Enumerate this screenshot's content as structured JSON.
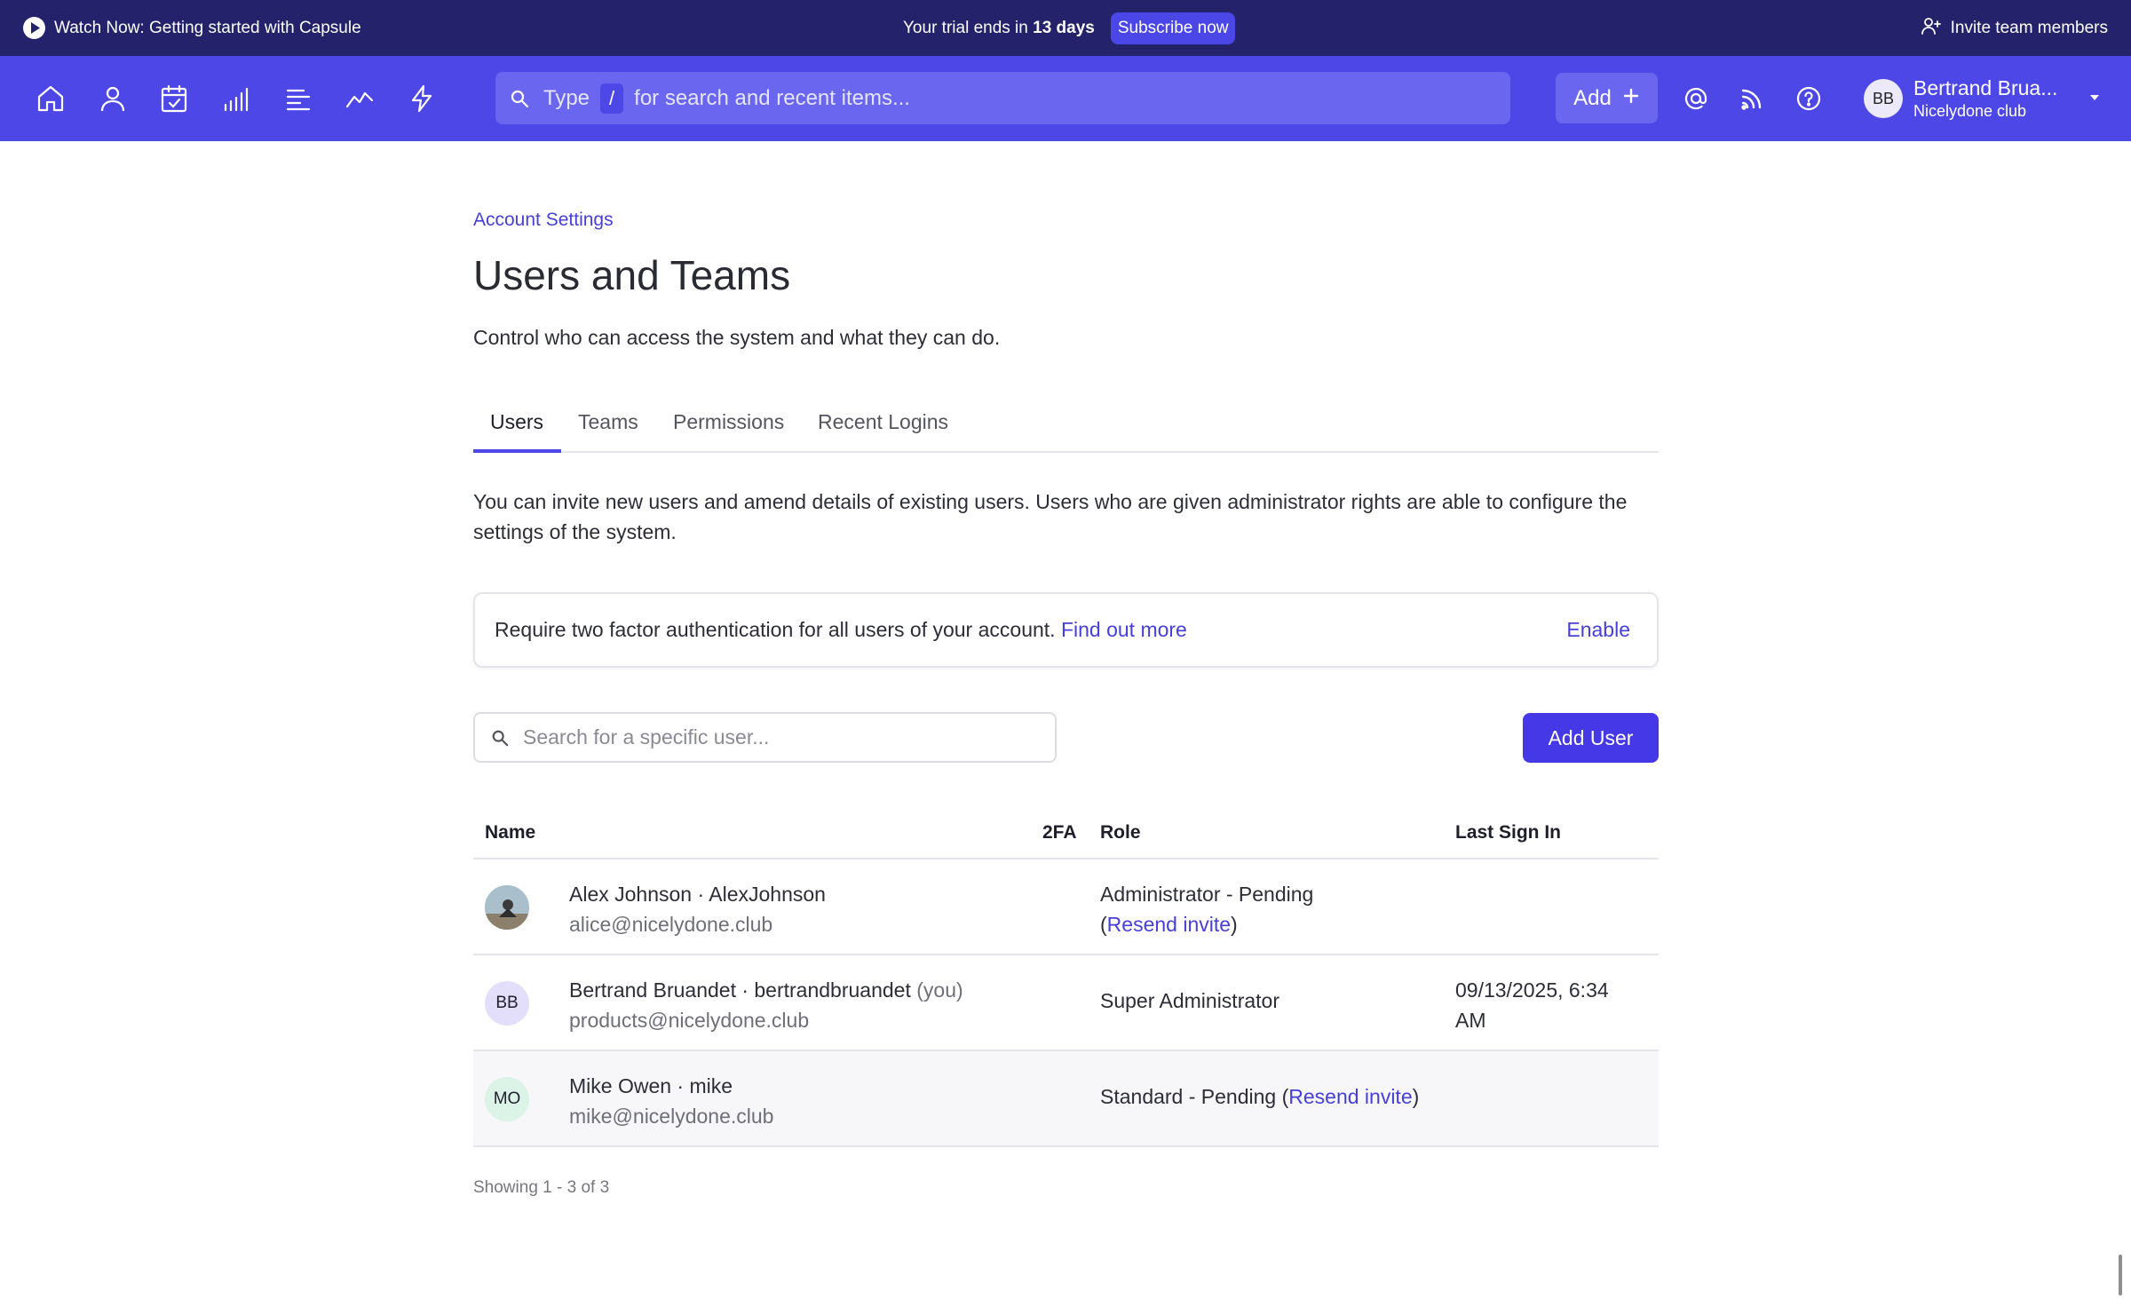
{
  "banner": {
    "watch_label": "Watch Now: Getting started with Capsule",
    "trial_prefix": "Your trial ends in",
    "trial_days": "13 days",
    "subscribe_label": "Subscribe now",
    "invite_label": "Invite team members"
  },
  "nav": {
    "icons": [
      "home-icon",
      "person-icon",
      "calendar-check-icon",
      "bar-chart-icon",
      "list-icon",
      "trend-line-icon",
      "lightning-icon"
    ],
    "search_type": "Type",
    "search_key": "/",
    "search_placeholder": "for search and recent items...",
    "add_label": "Add",
    "user_initials": "BB",
    "user_name": "Bertrand Brua...",
    "user_org": "Nicelydone club"
  },
  "page": {
    "breadcrumb": "Account Settings",
    "title": "Users and Teams",
    "description": "Control who can access the system and what they can do.",
    "tabs": [
      "Users",
      "Teams",
      "Permissions",
      "Recent Logins"
    ],
    "intro": "You can invite new users and amend details of existing users. Users who are given administrator rights are able to configure the settings of the system.",
    "tfa_text": "Require two factor authentication for all users of your account.",
    "tfa_link": "Find out more",
    "tfa_enable": "Enable",
    "user_search_placeholder": "Search for a specific user...",
    "add_user_label": "Add User",
    "showing": "Showing 1 - 3 of 3"
  },
  "table": {
    "headers": {
      "name": "Name",
      "tfa": "2FA",
      "role": "Role",
      "last": "Last Sign In"
    },
    "rows": [
      {
        "initials": "",
        "avatar_color": "#b9c6cf",
        "name_line": "Alex Johnson · AlexJohnson",
        "you": "",
        "email": "alice@nicelydone.club",
        "role_line1": "Administrator - Pending",
        "role_open": "(",
        "role_link": "Resend invite",
        "role_close": ")",
        "last_line1": "",
        "last_line2": ""
      },
      {
        "initials": "BB",
        "avatar_color": "#e3defa",
        "name_line": "Bertrand Bruandet · bertrandbruandet",
        "you": "(you)",
        "email": "products@nicelydone.club",
        "role": "Super Administrator",
        "last_line1": "09/13/2025, 6:34",
        "last_line2": "AM"
      },
      {
        "initials": "MO",
        "avatar_color": "#dcf3e8",
        "name_line": "Mike Owen · mike",
        "you": "",
        "email": "mike@nicelydone.club",
        "role_prefix": "Standard - Pending (",
        "role_link": "Resend invite",
        "role_close": ")"
      }
    ]
  },
  "colors": {
    "banner_bg": "#23226a",
    "nav_bg": "#4d47e8",
    "accent": "#4538e6",
    "link": "#4640d9"
  }
}
